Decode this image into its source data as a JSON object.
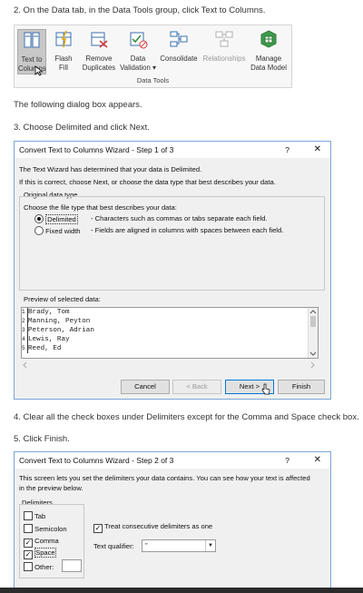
{
  "steps": {
    "s2": "2. On the Data tab, in the Data Tools group, click Text to Columns.",
    "appears": "The following dialog box appears.",
    "s3": "3. Choose Delimited and click Next.",
    "s4": "4. Clear all the check boxes under Delimiters except for the Comma and Space check box.",
    "s5": "5. Click Finish."
  },
  "ribbon": {
    "group_label": "Data Tools",
    "buttons": [
      {
        "l1": "Text to",
        "l2": "Columns"
      },
      {
        "l1": "Flash",
        "l2": "Fill"
      },
      {
        "l1": "Remove",
        "l2": "Duplicates"
      },
      {
        "l1": "Data",
        "l2": "Validation ▾"
      },
      {
        "l1": "Consolidate",
        "l2": ""
      },
      {
        "l1": "Relationships",
        "l2": ""
      },
      {
        "l1": "Manage",
        "l2": "Data Model"
      }
    ]
  },
  "dialog1": {
    "title": "Convert Text to Columns Wizard - Step 1 of 3",
    "help": "?",
    "close": "✕",
    "line1": "The Text Wizard has determined that your data is Delimited.",
    "line2": "If this is correct, choose Next, or choose the data type that best describes your data.",
    "group_label": "Original data type",
    "choose_label": "Choose the file type that best describes your data:",
    "opt1": "Delimited",
    "opt1_desc": "- Characters such as commas or tabs separate each field.",
    "opt2": "Fixed width",
    "opt2_desc": "- Fields are aligned in columns with spaces between each field.",
    "preview_label": "Preview of selected data:",
    "preview_rows": [
      {
        "n": "1",
        "t": "Brady, Tom"
      },
      {
        "n": "2",
        "t": "Manning, Peyton"
      },
      {
        "n": "3",
        "t": "Peterson, Adrian"
      },
      {
        "n": "4",
        "t": "Lewis, Ray"
      },
      {
        "n": "5",
        "t": "Reed, Ed"
      }
    ],
    "btn_cancel": "Cancel",
    "btn_back": "< Back",
    "btn_next": "Next >",
    "btn_finish": "Finish"
  },
  "dialog2": {
    "title": "Convert Text to Columns Wizard - Step 2 of 3",
    "help": "?",
    "close": "✕",
    "line1": "This screen lets you set the delimiters your data contains.  You can see how your text is affected",
    "line2": "in the preview below.",
    "delims_label": "Delimiters",
    "tab": "Tab",
    "semicolon": "Semicolon",
    "comma": "Comma",
    "space": "Space",
    "other": "Other:",
    "consecutive": "Treat consecutive delimiters as one",
    "qualifier_label": "Text qualifier:",
    "qualifier_value": "\""
  }
}
